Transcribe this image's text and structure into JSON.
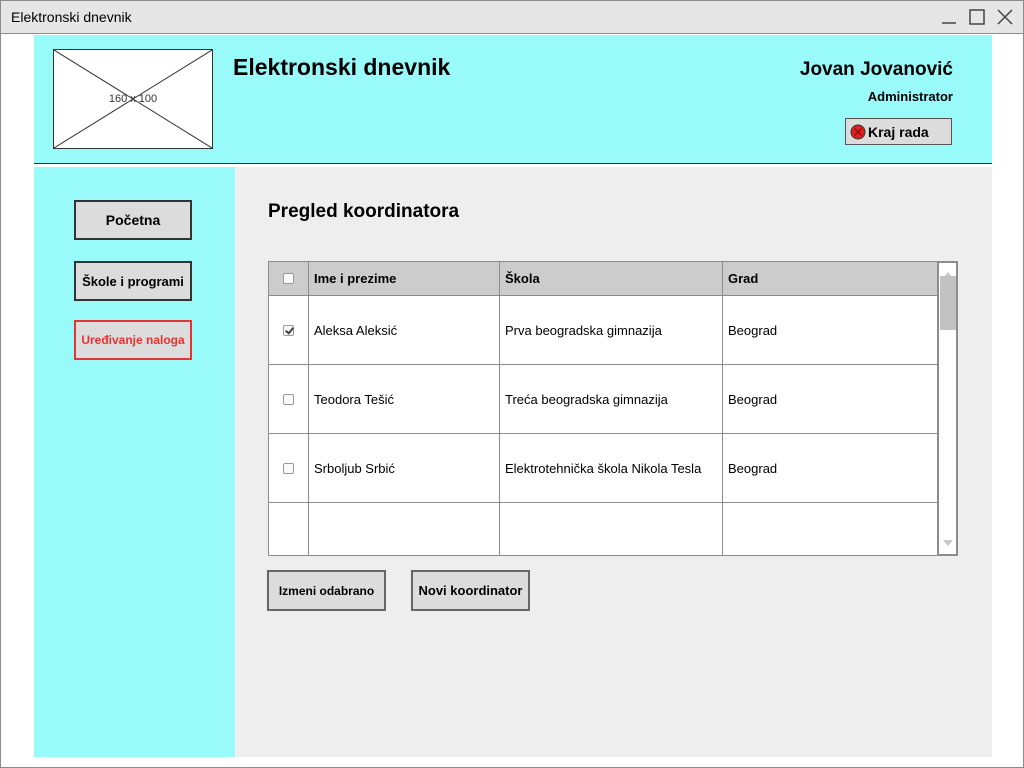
{
  "window": {
    "title": "Elektronski dnevnik"
  },
  "header": {
    "logo_placeholder": "160 x 100",
    "app_title": "Elektronski dnevnik",
    "user_name": "Jovan Jovanović",
    "user_role": "Administrator",
    "logout_label": "Kraj rada",
    "logout_icon": "stop-icon",
    "logout_icon_color": "#e02020",
    "background_color": "#99fafa"
  },
  "sidebar": {
    "items": [
      {
        "label": "Početna"
      },
      {
        "label": "Škole i programi"
      },
      {
        "label": "Uređivanje naloga",
        "color": "#e63232",
        "active": true
      }
    ]
  },
  "main": {
    "title": "Pregled koordinatora",
    "table": {
      "headers": [
        "Ime i prezime",
        "Škola",
        "Grad"
      ],
      "rows": [
        {
          "checked": true,
          "name": "Aleksa Aleksić",
          "school": "Prva beogradska gimnazija",
          "city": "Beograd"
        },
        {
          "checked": false,
          "name": "Teodora Tešić",
          "school": "Treća beogradska gimnazija",
          "city": "Beograd"
        },
        {
          "checked": false,
          "name": "Srboljub Srbić",
          "school": "Elektrotehnička škola Nikola Tesla",
          "city": "Beograd"
        }
      ]
    },
    "buttons": {
      "edit_selected": "Izmeni odabrano",
      "new_coordinator": "Novi koordinator"
    }
  }
}
